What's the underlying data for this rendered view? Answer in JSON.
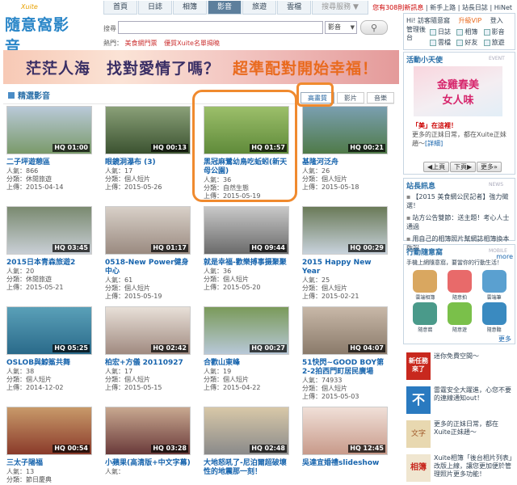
{
  "logo": {
    "brand": "Xuite",
    "title": "隨意窩影音"
  },
  "nav": {
    "tabs": [
      "首頁",
      "日誌",
      "相簿",
      "影音",
      "旅遊",
      "雲檔",
      "搜尋服務 ▼"
    ],
    "active_index": 3
  },
  "toplinks": {
    "new_msgs": "您有308則新訊息",
    "newbie": "新手上路",
    "sitemap": "站長日誌",
    "hinet": "HiNet"
  },
  "search": {
    "label": "搜尋",
    "placeholder": "",
    "scope": "影音"
  },
  "hot": {
    "label": "熱門：",
    "link1": "美食網門票",
    "link2": "優質Xuite名單揭曉"
  },
  "banner": {
    "text1": "茫茫人海",
    "text2": "找對愛情了嗎？",
    "text3": "超準配對開始幸福！"
  },
  "section": {
    "title": "精選影音"
  },
  "tabs": [
    "高畫質",
    "影片",
    "音樂"
  ],
  "videos": [
    {
      "title": "二子坪遊憩區",
      "dur": "HQ 01:00",
      "views": "人氣：866",
      "cat": "分類：休閒旅遊",
      "date": "上傳：2015-04-14",
      "c1": "#7a9a6a",
      "c2": "#b9c9d8"
    },
    {
      "title": "眼鏡洞瀑布 (3)",
      "dur": "HQ 00:13",
      "views": "人氣：17",
      "cat": "分類：個人短片",
      "date": "上傳：2015-05-26",
      "c1": "#3b5230",
      "c2": "#8aa078"
    },
    {
      "title": "黑冠麻鷺幼鳥吃蚯蚓(新天母公園)",
      "dur": "HQ 01:57",
      "views": "人氣：36",
      "cat": "分類：自然生態",
      "date": "上傳：2015-05-19",
      "c1": "#5f8a3a",
      "c2": "#9cbf6a"
    },
    {
      "title": "基隆河泛舟",
      "dur": "HQ 00:21",
      "views": "人氣：26",
      "cat": "分類：個人短片",
      "date": "上傳：2015-05-18",
      "c1": "#4f7a48",
      "c2": "#7a9fb0"
    },
    {
      "title": "2015日本青森旅遊2",
      "dur": "HQ 03:45",
      "views": "人氣：20",
      "cat": "分類：休閒旅遊",
      "date": "上傳：2015-05-21",
      "c1": "#c9cfd6",
      "c2": "#7a8a70"
    },
    {
      "title": "0518-New Power健身中心",
      "dur": "HQ 01:17",
      "views": "人氣：61",
      "cat": "分類：個人短片",
      "date": "上傳：2015-05-19",
      "c1": "#9a8a80",
      "c2": "#d8d0c8"
    },
    {
      "title": "就是幸福-歡樂搏事摄聚聚",
      "dur": "HQ 09:44",
      "views": "人氣：36",
      "cat": "分類：個人短片",
      "date": "上傳：2015-05-20",
      "c1": "#6a6a6a",
      "c2": "#c8c8c8"
    },
    {
      "title": "2015 Happy New Year",
      "dur": "HQ 00:29",
      "views": "人氣：25",
      "cat": "分類：個人短片",
      "date": "上傳：2015-02-21",
      "c1": "#c8d2dc",
      "c2": "#6a7a58"
    },
    {
      "title": "OSLOB與鯨鯊共舞",
      "dur": "HQ 05:25",
      "views": "人氣：38",
      "cat": "分類：個人短片",
      "date": "上傳：2014-12-02",
      "c1": "#2a6a8a",
      "c2": "#5aa0b8"
    },
    {
      "title": "柏宏+方儀 20110927",
      "dur": "HQ 02:42",
      "views": "人氣：17",
      "cat": "分類：個人短片",
      "date": "上傳：2015-05-15",
      "c1": "#a08a80",
      "c2": "#e8e0d8"
    },
    {
      "title": "合歡山東峰",
      "dur": "HQ 00:27",
      "views": "人氣：19",
      "cat": "分類：個人短片",
      "date": "上傳：2015-04-22",
      "c1": "#b8c8d8",
      "c2": "#7a9a5a"
    },
    {
      "title": "51快閃~GOOD BOY第2-2拍西門町居民廣場",
      "dur": "HQ 04:07",
      "views": "人氣：74933",
      "cat": "分類：個人短片",
      "date": "上傳：2015-05-03",
      "c1": "#8a7a6a",
      "c2": "#c8b8a8"
    },
    {
      "title": "三太子陽福",
      "dur": "HQ 00:54",
      "views": "人氣：13",
      "cat": "分類：節日慶典",
      "date": "",
      "c1": "#8a3a2a",
      "c2": "#c89a6a"
    },
    {
      "title": "小蘋果(高清版+中文字幕)",
      "dur": "HQ 03:28",
      "views": "人氣：",
      "cat": "",
      "date": "",
      "c1": "#6a3a3a",
      "c2": "#c8a890"
    },
    {
      "title": "大地怒吼了-尼泊爾超破壞性的地震那一刻！",
      "dur": "HQ 02:48",
      "views": "",
      "cat": "",
      "date": "",
      "c1": "#8a8a8a",
      "c2": "#d8c8a8"
    },
    {
      "title": "吳達宜婚禮slideshow",
      "dur": "HQ 12:45",
      "views": "",
      "cat": "",
      "date": "",
      "c1": "#c89a8a",
      "c2": "#f0e0d8"
    }
  ],
  "sidebar": {
    "greeting": "Hi! 訪客",
    "greeting_suffix": "隨意窩",
    "vip": "升級VIP",
    "login": "登入",
    "manage": "管理後台",
    "services": [
      "日誌",
      "相簿",
      "影音",
      "雲檔",
      "好友",
      "旅遊"
    ],
    "angel_title": "活動小天使",
    "angel_en": "EVENT",
    "angel_img_t1": "金雞春美",
    "angel_img_t2": "女人味",
    "angel_bold": "「美」在這裡！",
    "angel_body": "更多的正妹日常，都在Xuite正妹趙～",
    "angel_more": "[詳細]",
    "prev": "上頁",
    "next": "下頁",
    "more": "更多",
    "news_title": "站長訊息",
    "news_en": "NEWS",
    "news": [
      "【2015 美食網公民記者】強力徵選！",
      "站方公告雙節：送主題！考心人士通過",
      "用自己的相簿照片幫網誌相簿換本版設"
    ],
    "news_more": "more",
    "mobile_title": "行動隨意窩",
    "mobile_en": "MOBILE",
    "mobile_desc": "手機上網隨意窩，要當你的行動生活！",
    "apps": [
      "雲端相簿",
      "隨意拍",
      "雲端筆",
      "隨意窩",
      "隨意遊",
      "隨意聽"
    ],
    "apps_more": "更多",
    "promos": [
      {
        "pic": "新任務來了",
        "text": "迷你免費空間～"
      },
      {
        "pic": "不",
        "text": "雷霆安全大躍進，心您不要的連線通知out！"
      },
      {
        "pic": "文字",
        "text": "更多的正妹日常，都在Xuite正妹趙～"
      },
      {
        "pic": "相簿",
        "text": "Xuite相簿「後台相片列表」改版上線，讓您更加便於管理照片更多功能！"
      }
    ]
  }
}
